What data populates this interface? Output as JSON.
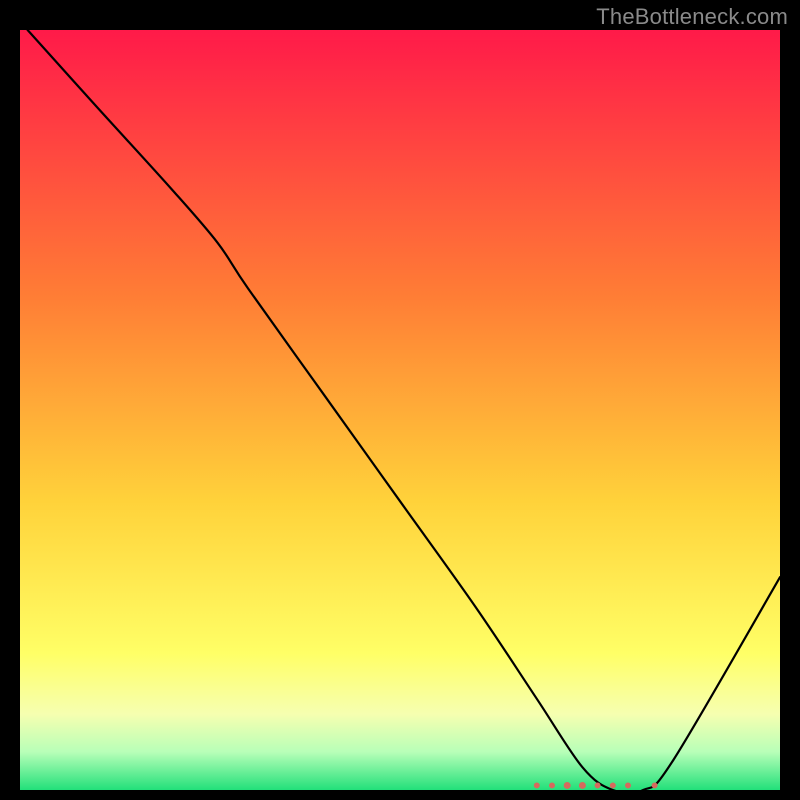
{
  "watermark": "TheBottleneck.com",
  "chart_data": {
    "type": "line",
    "title": "",
    "xlabel": "",
    "ylabel": "",
    "xlim": [
      0,
      100
    ],
    "ylim": [
      0,
      100
    ],
    "grid": false,
    "legend": false,
    "background_gradient": {
      "stops": [
        {
          "offset": 0.0,
          "color": "#ff1a49"
        },
        {
          "offset": 0.35,
          "color": "#ff7d35"
        },
        {
          "offset": 0.62,
          "color": "#ffd23a"
        },
        {
          "offset": 0.82,
          "color": "#ffff66"
        },
        {
          "offset": 0.9,
          "color": "#f6ffb0"
        },
        {
          "offset": 0.95,
          "color": "#b8ffb8"
        },
        {
          "offset": 1.0,
          "color": "#22e07a"
        }
      ]
    },
    "series": [
      {
        "name": "curve",
        "color": "#000000",
        "x": [
          1,
          10,
          20,
          26,
          30,
          40,
          50,
          60,
          68,
          74,
          78,
          82,
          86,
          100
        ],
        "y": [
          100,
          90,
          79,
          72,
          66,
          52,
          38,
          24,
          12,
          3,
          0,
          0,
          4,
          28
        ]
      }
    ],
    "markers": {
      "name": "bottom-dots",
      "color": "#d66a5d",
      "points": [
        {
          "x": 68,
          "y": 0.6,
          "r": 3
        },
        {
          "x": 70,
          "y": 0.6,
          "r": 3
        },
        {
          "x": 72,
          "y": 0.6,
          "r": 3.5
        },
        {
          "x": 74,
          "y": 0.6,
          "r": 3.5
        },
        {
          "x": 76,
          "y": 0.6,
          "r": 3
        },
        {
          "x": 78,
          "y": 0.6,
          "r": 3
        },
        {
          "x": 80,
          "y": 0.6,
          "r": 3
        },
        {
          "x": 83.5,
          "y": 0.6,
          "r": 3
        }
      ]
    }
  }
}
